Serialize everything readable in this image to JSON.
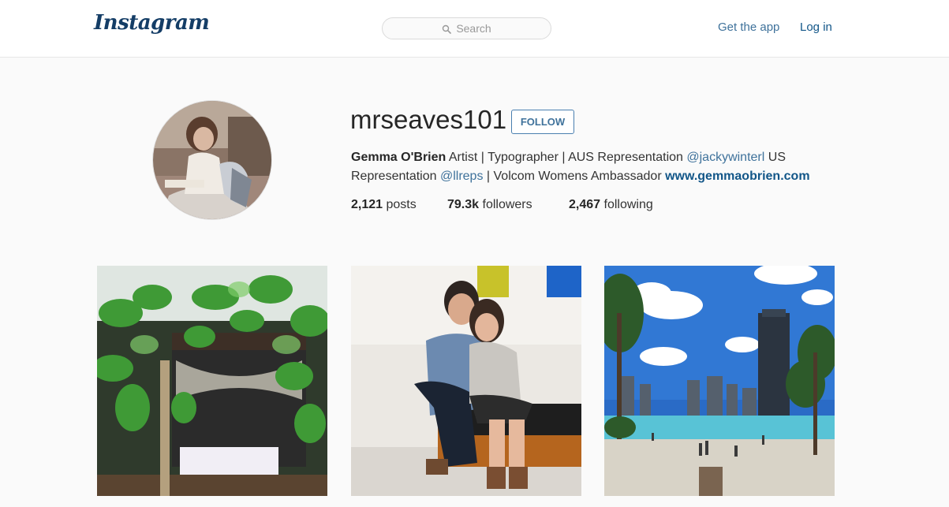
{
  "header": {
    "logo": "Instagram",
    "search_placeholder": "Search",
    "get_app": "Get the app",
    "login": "Log in"
  },
  "profile": {
    "username": "mrseaves101",
    "follow_label": "FOLLOW",
    "full_name": "Gemma O'Brien",
    "bio_part1": "Artist | Typographer | AUS Representation",
    "mention1": "@jackywinterl",
    "bio_part2": "US Representation",
    "mention2": "@llreps",
    "bio_part3": "| Volcom Womens Ambassador",
    "website": "www.gemmaobrien.com",
    "stats": {
      "posts_count": "2,121",
      "posts_label": "posts",
      "followers_count": "79.3k",
      "followers_label": "followers",
      "following_count": "2,467",
      "following_label": "following"
    }
  },
  "photos": [
    {
      "subject": "garden-bed-photo"
    },
    {
      "subject": "couple-photo"
    },
    {
      "subject": "beach-city-photo"
    }
  ],
  "colors": {
    "link_blue": "#3f729b",
    "dark_blue": "#125688",
    "logo_blue": "#143d66",
    "background": "#fafafa"
  }
}
